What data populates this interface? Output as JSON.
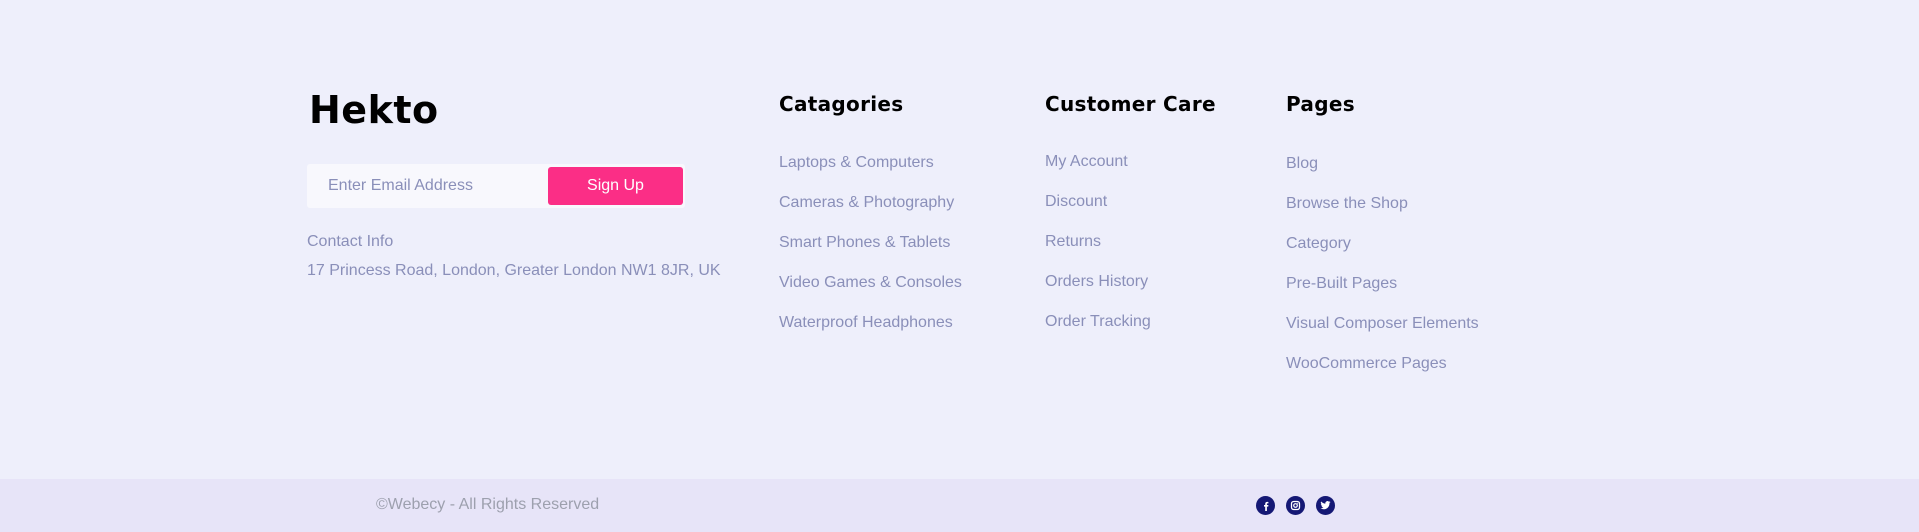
{
  "brand": {
    "name": "Hekto"
  },
  "newsletter": {
    "email_placeholder": "Enter Email Address",
    "email_value": "",
    "signup_label": "Sign Up"
  },
  "contact": {
    "label": "Contact Info",
    "address": "17 Princess Road, London, Greater London NW1 8JR, UK"
  },
  "columns": {
    "categories": {
      "title": "Catagories",
      "items": [
        "Laptops & Computers",
        "Cameras & Photography",
        "Smart Phones & Tablets",
        "Video Games & Consoles",
        "Waterproof Headphones"
      ]
    },
    "customer_care": {
      "title": "Customer Care",
      "items": [
        "My Account",
        "Discount",
        "Returns",
        "Orders History",
        "Order Tracking"
      ]
    },
    "pages": {
      "title": "Pages",
      "items": [
        "Blog",
        "Browse the Shop",
        "Category",
        "Pre-Built Pages",
        "Visual Composer Elements",
        "WooCommerce Pages"
      ]
    }
  },
  "bottom_bar": {
    "copyright": "©Webecy - All Rights Reserved",
    "social_icons": [
      "facebook-icon",
      "instagram-icon",
      "twitter-icon"
    ]
  },
  "colors": {
    "footer_bg": "#EEEFFB",
    "bottom_bar_bg": "#E7E4F8",
    "accent_pink": "#FB2E86",
    "navy": "#151875",
    "muted_text": "#8A8FB9"
  }
}
